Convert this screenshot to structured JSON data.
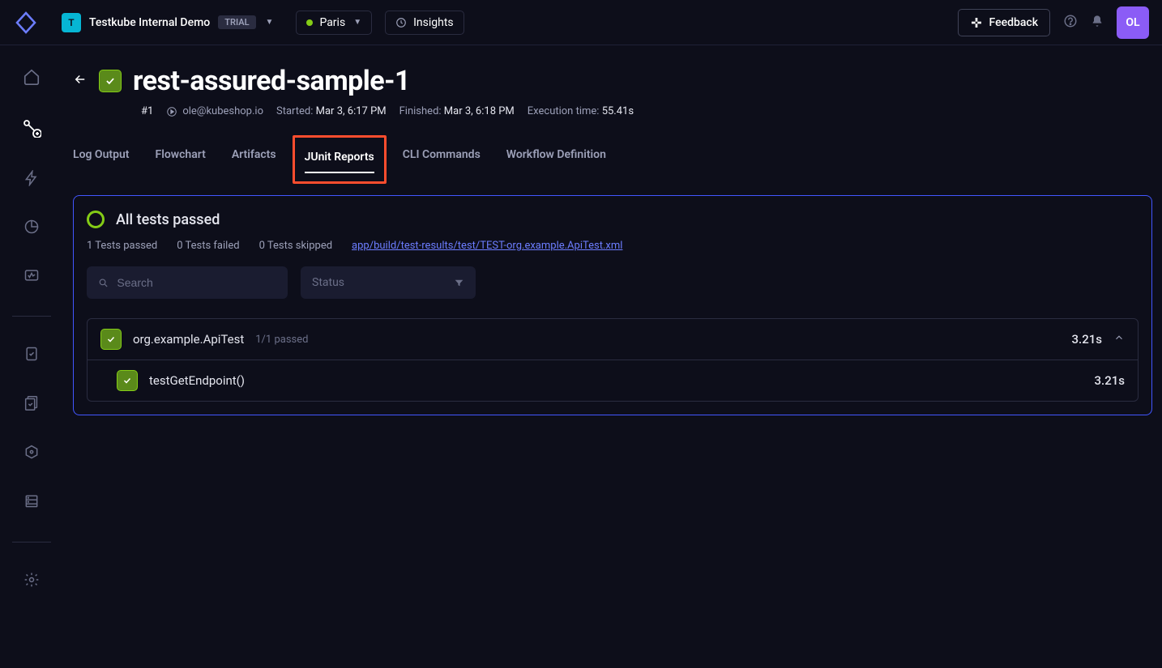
{
  "header": {
    "org_letter": "T",
    "org_name": "Testkube Internal Demo",
    "trial_label": "TRIAL",
    "env_name": "Paris",
    "insights_label": "Insights",
    "feedback_label": "Feedback",
    "user_initials": "OL"
  },
  "page": {
    "title": "rest-assured-sample-1",
    "run_number": "#1",
    "runner": "ole@kubeshop.io",
    "started_label": "Started:",
    "started_value": "Mar 3, 6:17 PM",
    "finished_label": "Finished:",
    "finished_value": "Mar 3, 6:18 PM",
    "exec_label": "Execution time:",
    "exec_value": "55.41s"
  },
  "tabs": {
    "log_output": "Log Output",
    "flowchart": "Flowchart",
    "artifacts": "Artifacts",
    "junit_reports": "JUnit Reports",
    "cli_commands": "CLI Commands",
    "workflow_def": "Workflow Definition"
  },
  "report": {
    "summary_title": "All tests passed",
    "passed": "1 Tests passed",
    "failed": "0 Tests failed",
    "skipped": "0 Tests skipped",
    "file_link": "app/build/test-results/test/TEST-org.example.ApiTest.xml",
    "search_placeholder": "Search",
    "status_label": "Status",
    "suite": {
      "name": "org.example.ApiTest",
      "count": "1/1 passed",
      "time": "3.21s"
    },
    "tests": [
      {
        "name": "testGetEndpoint()",
        "time": "3.21s"
      }
    ]
  }
}
